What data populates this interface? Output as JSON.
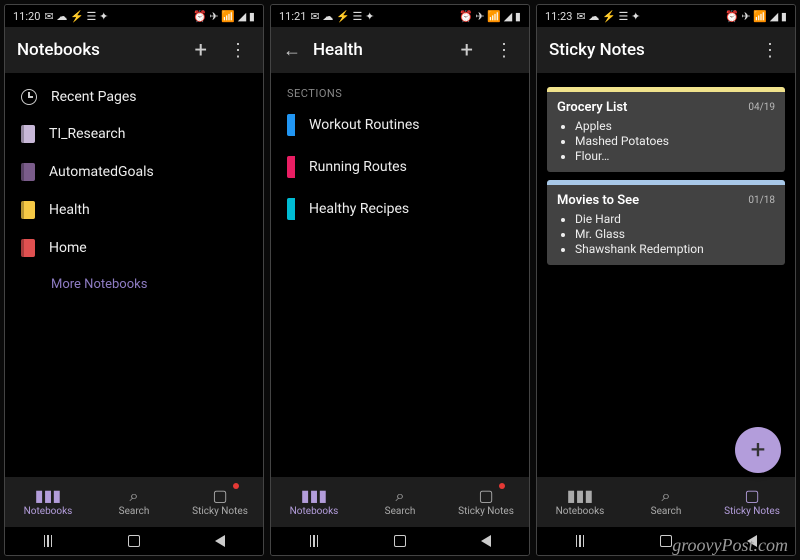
{
  "watermark": "groovyPost.com",
  "screens": [
    {
      "status_time": "11:20",
      "title": "Notebooks",
      "has_back": false,
      "has_plus": true,
      "has_more": true,
      "recent_label": "Recent Pages",
      "notebooks": [
        {
          "label": "TI_Research",
          "color": "#c8b8d8"
        },
        {
          "label": "AutomatedGoals",
          "color": "#7a5c8a"
        },
        {
          "label": "Health",
          "color": "#f6c945"
        },
        {
          "label": "Home",
          "color": "#e05050"
        }
      ],
      "more_label": "More Notebooks",
      "nav": {
        "notebooks": "Notebooks",
        "search": "Search",
        "sticky": "Sticky Notes",
        "active": 0
      }
    },
    {
      "status_time": "11:21",
      "title": "Health",
      "has_back": true,
      "has_plus": true,
      "has_more": true,
      "sections_label": "SECTIONS",
      "sections": [
        {
          "label": "Workout Routines",
          "color": "#2196f3"
        },
        {
          "label": "Running Routes",
          "color": "#e91e63"
        },
        {
          "label": "Healthy Recipes",
          "color": "#00bcd4"
        }
      ],
      "nav": {
        "notebooks": "Notebooks",
        "search": "Search",
        "sticky": "Sticky Notes",
        "active": 0
      }
    },
    {
      "status_time": "11:23",
      "title": "Sticky Notes",
      "has_back": false,
      "has_plus": false,
      "has_more": true,
      "notes": [
        {
          "title": "Grocery List",
          "date": "04/19",
          "stripe": "#f0e28c",
          "items": [
            "Apples",
            "Mashed Potatoes",
            "Flour…"
          ]
        },
        {
          "title": "Movies to See",
          "date": "01/18",
          "stripe": "#a8c8e8",
          "items": [
            "Die Hard",
            "Mr. Glass",
            "Shawshank Redemption"
          ]
        }
      ],
      "fab_label": "+",
      "nav": {
        "notebooks": "Notebooks",
        "search": "Search",
        "sticky": "Sticky Notes",
        "active": 2
      }
    }
  ]
}
